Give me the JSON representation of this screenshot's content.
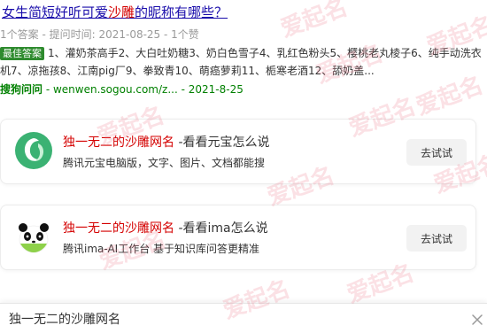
{
  "result": {
    "title_prefix": "女生简短好听可爱",
    "title_highlight": "沙雕",
    "title_suffix": "的昵称有哪些？",
    "meta": "1个答案 - 提问时间: 2021-08-25 - 1个赞",
    "best_badge": "最佳答案",
    "snippet": "1、灌奶茶高手2、大白吐奶糖3、奶白色雪子4、乳红色粉头5、樱桃老丸棱子6、纯手动洗衣机7、凉拖孩8、江南pig厂9、拳致青10、萌癌萝莉11、栀寒老酒12、舔奶盖...",
    "source_site": "搜狗问问",
    "source_rest": " - wenwen.sogou.com/z... - 2021-8-25"
  },
  "cards": [
    {
      "title_red": "独一无二的沙雕网名",
      "title_rest": " -看看元宝怎么说",
      "desc": "腾讯元宝电脑版，文字、图片、文档都能搜",
      "button": "去试试",
      "icon": "yuanbao-logo-icon"
    },
    {
      "title_red": "独一无二的沙雕网名",
      "title_rest": " -看看ima怎么说",
      "desc": "腾讯ima-AI工作台 基于知识库问答更精准",
      "button": "去试试",
      "icon": "ima-panda-logo-icon"
    }
  ],
  "search": {
    "value": "独一无二的沙雕网名"
  },
  "watermark": "爱起名",
  "colors": {
    "link": "#1a0dab",
    "highlight": "#d40000",
    "source_green": "#008000",
    "badge_green": "#2e8b2e",
    "yuanbao_green": "#3bb273",
    "ima_green": "#8ed14a"
  }
}
